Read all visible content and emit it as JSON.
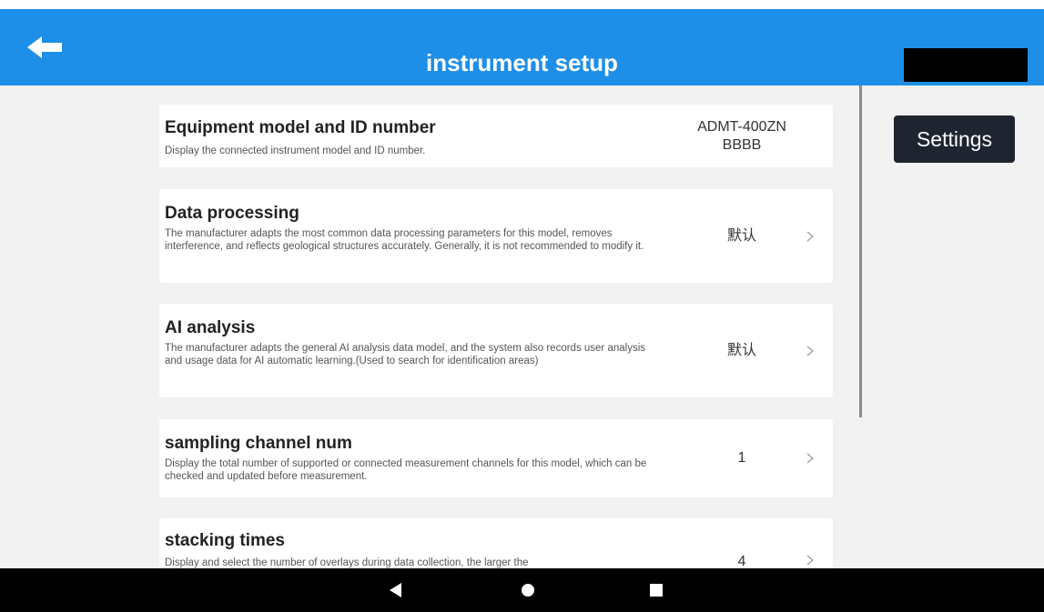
{
  "header": {
    "title": "instrument setup"
  },
  "settings_button": "Settings",
  "items": [
    {
      "title": "Equipment model and ID number",
      "description": "Display the connected instrument model and ID number.",
      "value_line1": "ADMT-400ZN",
      "value_line2": "BBBB"
    },
    {
      "title": "Data processing",
      "description": "The manufacturer adapts the most common data processing parameters for this model, removes interference, and reflects geological structures accurately. Generally, it is not recommended to modify it.",
      "value": "默认"
    },
    {
      "title": "AI analysis",
      "description": "The manufacturer adapts the general AI analysis data model, and the system also records user analysis and usage data for AI automatic learning.(Used to search for identification areas)",
      "value": "默认"
    },
    {
      "title": "sampling channel num",
      "description": "Display the total number of supported or connected measurement channels for this model, which can be checked and updated before measurement.",
      "value": "1"
    },
    {
      "title": "stacking times",
      "description": "Display and select the number of overlays during data collection, the larger the",
      "value": "4"
    }
  ],
  "colors": {
    "app_bar": "#1e8fe8",
    "background": "#f2f2f2",
    "settings_button": "#1e2530",
    "nav_bar": "#000000"
  },
  "icons": {
    "back": "back-arrow-icon",
    "chevron": "chevron-right-icon",
    "nav_back": "nav-back-icon",
    "nav_home": "nav-home-icon",
    "nav_recents": "nav-recents-icon"
  }
}
